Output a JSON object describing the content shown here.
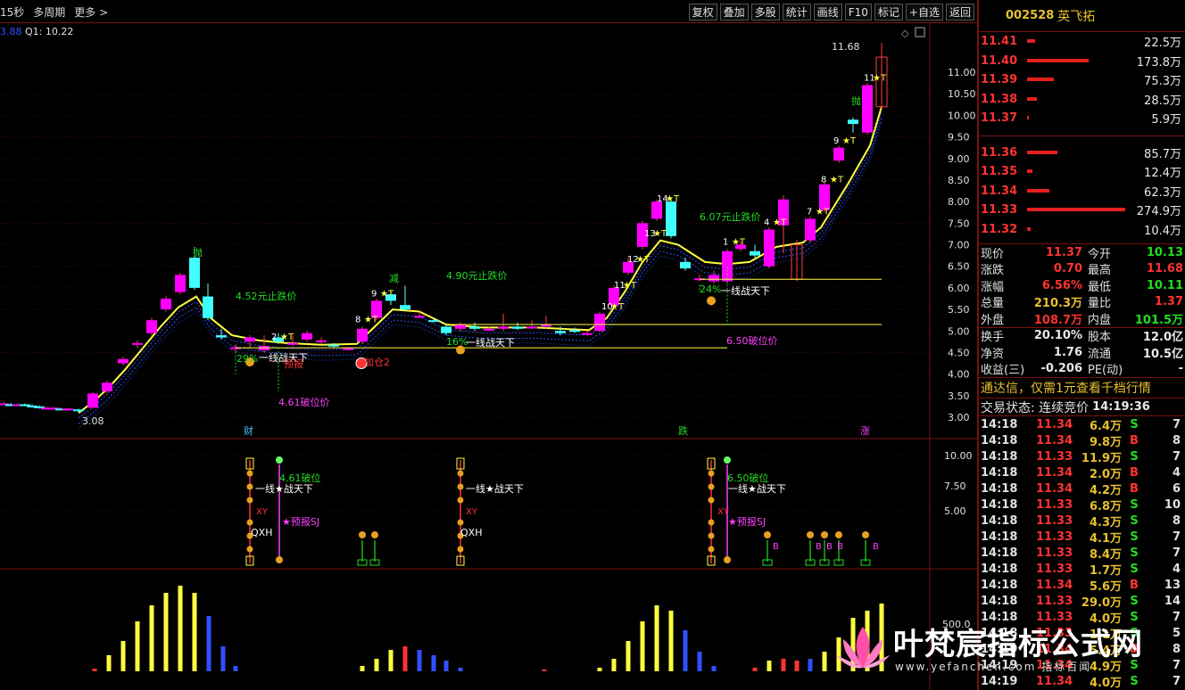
{
  "toolbar": {
    "left": [
      "15秒",
      "多周期",
      "更多 >"
    ],
    "buttons": [
      "复权",
      "叠加",
      "多股",
      "统计",
      "画线",
      "F10",
      "标记",
      "+自选",
      "返回"
    ]
  },
  "chart_header": {
    "left_value": "3.88",
    "q1": "Q1: 10.22"
  },
  "price_axis": [
    "11.00",
    "10.50",
    "10.00",
    "9.50",
    "9.00",
    "8.50",
    "8.00",
    "7.50",
    "7.00",
    "6.50",
    "6.00",
    "5.50",
    "5.00",
    "4.50",
    "4.00",
    "3.50",
    "3.00"
  ],
  "price_high_label": "11.68",
  "price_low_label": "3.08",
  "bottom_markers": [
    "财",
    "跌",
    "涨"
  ],
  "mid_axis": [
    "10.00",
    "7.50",
    "5.00"
  ],
  "vol_axis": "500.0",
  "annotations": {
    "lose1": "4.52元止跌价",
    "lose2": "4.90元止跌价",
    "lose3": "6.07元止跌价",
    "pct1": "29%",
    "pct2": "16%",
    "pct3": "24%",
    "zt1": "一线战天下",
    "zt2": "一线战天下",
    "zt3": "一线战天下",
    "broken1": "4.61破位价",
    "broken2": "6.50破位价",
    "yb": "预报",
    "jc": "加仓2",
    "sell1": "抛",
    "sell2": "抛",
    "reduce": "减",
    "stars": [
      "2",
      "8",
      "9",
      "10",
      "11",
      "12",
      "13",
      "14",
      "1",
      "4",
      "7",
      "8",
      "9",
      "11"
    ]
  },
  "mid_panel": {
    "g1": "4.61破位",
    "g2": "6.50破位",
    "xianzt": "一线★战天下",
    "xy": "XY",
    "qxh": "QXH",
    "ybsj": "★预报SJ",
    "b": "B"
  },
  "stock": {
    "code": "002528",
    "name": "英飞拓"
  },
  "asks": [
    {
      "price": "11.41",
      "vol": "22.5万",
      "bar": 0.08
    },
    {
      "price": "11.40",
      "vol": "173.8万",
      "bar": 0.63
    },
    {
      "price": "11.39",
      "vol": "75.3万",
      "bar": 0.27
    },
    {
      "price": "11.38",
      "vol": "28.5万",
      "bar": 0.1
    },
    {
      "price": "11.37",
      "vol": "5.9万",
      "bar": 0.02
    }
  ],
  "bids": [
    {
      "price": "11.36",
      "vol": "85.7万",
      "bar": 0.31
    },
    {
      "price": "11.35",
      "vol": "12.4万",
      "bar": 0.05
    },
    {
      "price": "11.34",
      "vol": "62.3万",
      "bar": 0.23
    },
    {
      "price": "11.33",
      "vol": "274.9万",
      "bar": 1.0
    },
    {
      "price": "11.32",
      "vol": "10.4万",
      "bar": 0.04
    }
  ],
  "stats": [
    {
      "l1": "现价",
      "v1": "11.37",
      "c1": "#ff3333",
      "l2": "今开",
      "v2": "10.13",
      "c2": "#22dd22"
    },
    {
      "l1": "涨跌",
      "v1": "0.70",
      "c1": "#ff3333",
      "l2": "最高",
      "v2": "11.68",
      "c2": "#ff3333"
    },
    {
      "l1": "涨幅",
      "v1": "6.56%",
      "c1": "#ff3333",
      "l2": "最低",
      "v2": "10.11",
      "c2": "#22dd22"
    },
    {
      "l1": "总量",
      "v1": "210.3万",
      "c1": "#e8c030",
      "l2": "量比",
      "v2": "1.37",
      "c2": "#ff3333"
    },
    {
      "l1": "外盘",
      "v1": "108.7万",
      "c1": "#ff3333",
      "l2": "内盘",
      "v2": "101.5万",
      "c2": "#22dd22"
    }
  ],
  "stats2": [
    {
      "l1": "换手",
      "v1": "20.10%",
      "l2": "股本",
      "v2": "12.0亿"
    },
    {
      "l1": "净资",
      "v1": "1.76",
      "l2": "流通",
      "v2": "10.5亿"
    },
    {
      "l1": "收益(三)",
      "v1": "-0.206",
      "l2": "PE(动)",
      "v2": "-"
    }
  ],
  "ad_text": "通达信，仅需1元查看千档行情",
  "trade_status": {
    "label": "交易状态: 连续竞价",
    "time": "14:19:36"
  },
  "ticks": [
    {
      "t": "14:18",
      "p": "11.34",
      "v": "6.4万",
      "d": "S",
      "n": "7"
    },
    {
      "t": "14:18",
      "p": "11.34",
      "v": "9.8万",
      "d": "B",
      "n": "8"
    },
    {
      "t": "14:18",
      "p": "11.33",
      "v": "11.9万",
      "d": "S",
      "n": "7"
    },
    {
      "t": "14:18",
      "p": "11.34",
      "v": "2.0万",
      "d": "B",
      "n": "4"
    },
    {
      "t": "14:18",
      "p": "11.34",
      "v": "4.2万",
      "d": "B",
      "n": "6"
    },
    {
      "t": "14:18",
      "p": "11.33",
      "v": "6.8万",
      "d": "S",
      "n": "10"
    },
    {
      "t": "14:18",
      "p": "11.33",
      "v": "4.3万",
      "d": "S",
      "n": "8"
    },
    {
      "t": "14:18",
      "p": "11.33",
      "v": "4.1万",
      "d": "S",
      "n": "7"
    },
    {
      "t": "14:18",
      "p": "11.33",
      "v": "8.4万",
      "d": "S",
      "n": "7"
    },
    {
      "t": "14:18",
      "p": "11.33",
      "v": "1.7万",
      "d": "S",
      "n": "4"
    },
    {
      "t": "14:18",
      "p": "11.34",
      "v": "5.6万",
      "d": "B",
      "n": "13"
    },
    {
      "t": "14:18",
      "p": "11.33",
      "v": "29.0万",
      "d": "S",
      "n": "14"
    },
    {
      "t": "14:18",
      "p": "11.33",
      "v": "4.0万",
      "d": "S",
      "n": "7"
    },
    {
      "t": "14:18",
      "p": "11.33",
      "v": "1.1万",
      "d": "S",
      "n": "5"
    },
    {
      "t": "14:19",
      "p": "11.34",
      "v": "5.4万",
      "d": "B",
      "n": "8"
    },
    {
      "t": "14:19",
      "p": "11.34",
      "v": "4.9万",
      "d": "S",
      "n": "7"
    },
    {
      "t": "14:19",
      "p": "11.34",
      "v": "4.0万",
      "d": "S",
      "n": "7"
    }
  ],
  "watermark": {
    "title": "叶梵宸指标公式网",
    "sub": "www.yefanchen.com 指标百闻"
  },
  "colors": {
    "up": "#ff00ff",
    "down": "#40ffff",
    "ma": "#ffff40",
    "band": "#3050ff",
    "grid": "#7a1010",
    "sell": "#22dd22",
    "buy": "#ff3333"
  }
}
